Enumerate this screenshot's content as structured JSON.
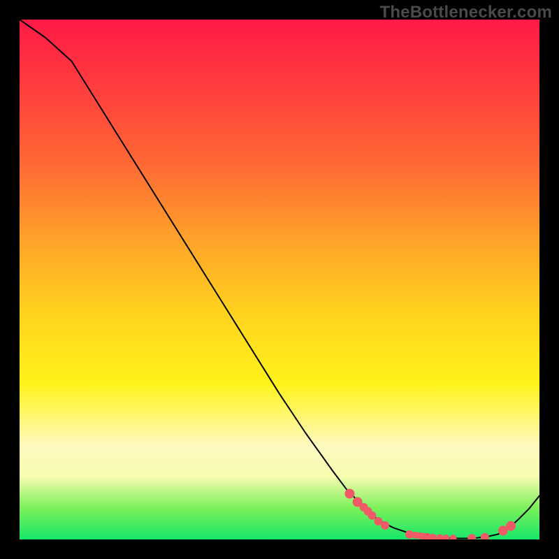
{
  "watermark": "TheBottlenecker.com",
  "colors": {
    "curve_stroke": "#000000",
    "marker_fill": "#ef5a66",
    "frame_bg": "#000000"
  },
  "chart_data": {
    "type": "line",
    "title": "",
    "xlabel": "",
    "ylabel": "",
    "xlim": [
      0,
      100
    ],
    "ylim": [
      0,
      100
    ],
    "x": [
      0,
      5,
      10,
      15,
      20,
      25,
      30,
      35,
      40,
      45,
      50,
      55,
      60,
      63,
      68,
      70,
      72,
      75,
      78,
      80,
      82,
      84,
      86,
      88,
      90,
      92,
      94,
      96,
      98,
      100
    ],
    "y": [
      100,
      96.5,
      92,
      84,
      76,
      68,
      60,
      52,
      44,
      36,
      28,
      20.5,
      13.5,
      9.5,
      4.5,
      3.2,
      2.2,
      1.2,
      0.6,
      0.35,
      0.25,
      0.2,
      0.2,
      0.3,
      0.55,
      1.0,
      2.1,
      3.9,
      5.9,
      8.4
    ],
    "markers": {
      "x": [
        63.5,
        65,
        66.2,
        67,
        67.8,
        69,
        70.3,
        75,
        76.1,
        77,
        77.8,
        78.5,
        79.5,
        80.8,
        82,
        83.4,
        87,
        89.5,
        93,
        94.5
      ],
      "y": [
        8.8,
        7.2,
        6.2,
        5.4,
        4.6,
        3.5,
        2.7,
        0.95,
        0.82,
        0.7,
        0.6,
        0.55,
        0.45,
        0.35,
        0.28,
        0.24,
        0.24,
        0.45,
        1.7,
        2.6
      ],
      "r": [
        7,
        7,
        6,
        6,
        6,
        6,
        6,
        6,
        5,
        5,
        5,
        5,
        5,
        5,
        5,
        5,
        6,
        6,
        7,
        7
      ]
    }
  }
}
